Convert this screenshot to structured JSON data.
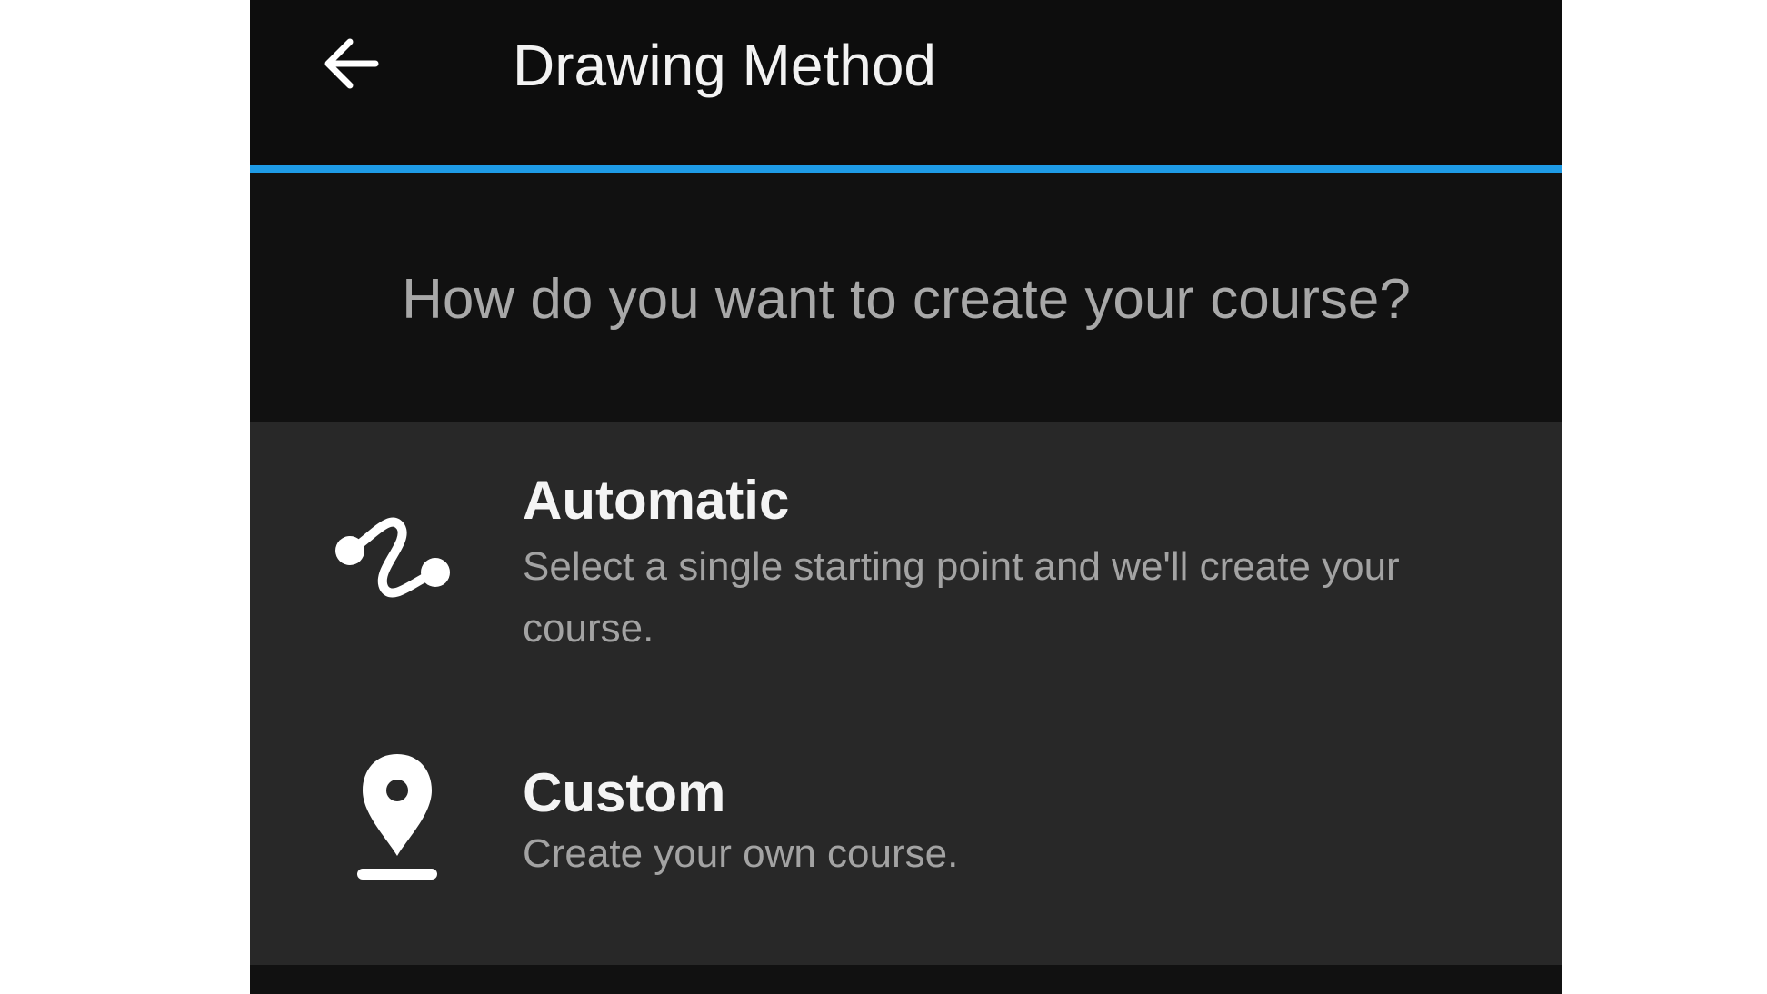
{
  "header": {
    "back_icon": "arrow-left-icon",
    "title": "Drawing Method"
  },
  "question": "How do you want to create your course?",
  "options": [
    {
      "icon": "route-squiggle-icon",
      "title": "Automatic",
      "description": "Select a single starting point and we'll create your course."
    },
    {
      "icon": "location-pin-icon",
      "title": "Custom",
      "description": "Create your own course."
    }
  ],
  "colors": {
    "accent": "#1e9be6",
    "background": "#111111",
    "panel": "#282828"
  }
}
